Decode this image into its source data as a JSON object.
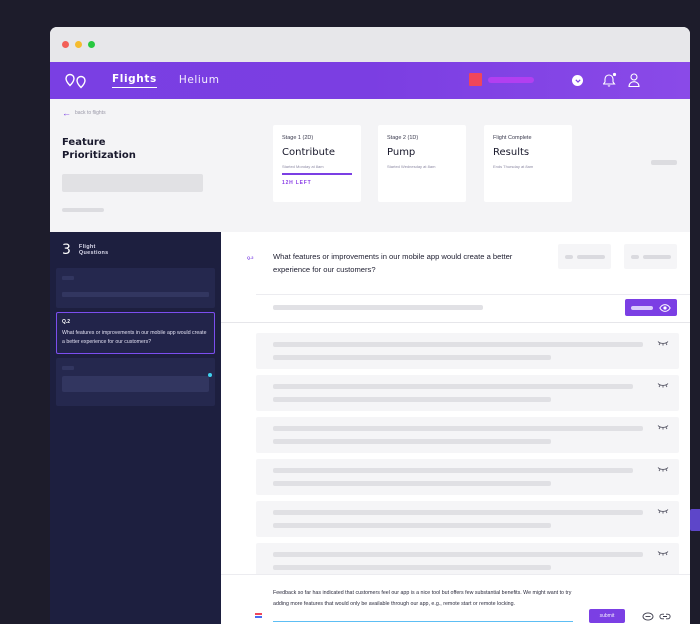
{
  "nav": {
    "tabs": [
      {
        "label": "Flights"
      },
      {
        "label": "Helium"
      }
    ]
  },
  "header": {
    "back_label": "back to flights",
    "title": "Feature Prioritization"
  },
  "stages": [
    {
      "label": "Stage 1 (2D)",
      "name": "Contribute",
      "sub": "Started Monday at 8am",
      "time_left": "12H LEFT"
    },
    {
      "label": "Stage 2 (1D)",
      "name": "Pump",
      "sub": "Started Wednesday at 8am"
    },
    {
      "label": "Flight Complete",
      "name": "Results",
      "sub": "Ends Thursday at 8am"
    }
  ],
  "sidebar": {
    "count": "3",
    "count_label": "Flight Questions",
    "active_question": {
      "number": "Q.2",
      "text": "What features or improvements in our mobile app would create a better experience for our customers?"
    }
  },
  "question": {
    "number": "Q.2",
    "text": "What features or improvements in our mobile app would create a better experience for our customers?"
  },
  "composer": {
    "text": "Feedback so far has indicated that customers feel our app is a nice tool but offers few substantial benefits. We might want to try adding more features that would only be available through our app, e.g., remote start or remote locking.",
    "submit_label": "submit"
  },
  "colors": {
    "brand": "#7b3fe4",
    "sidebar": "#1d1f3f",
    "accent_dot": "#3fd2ef"
  }
}
